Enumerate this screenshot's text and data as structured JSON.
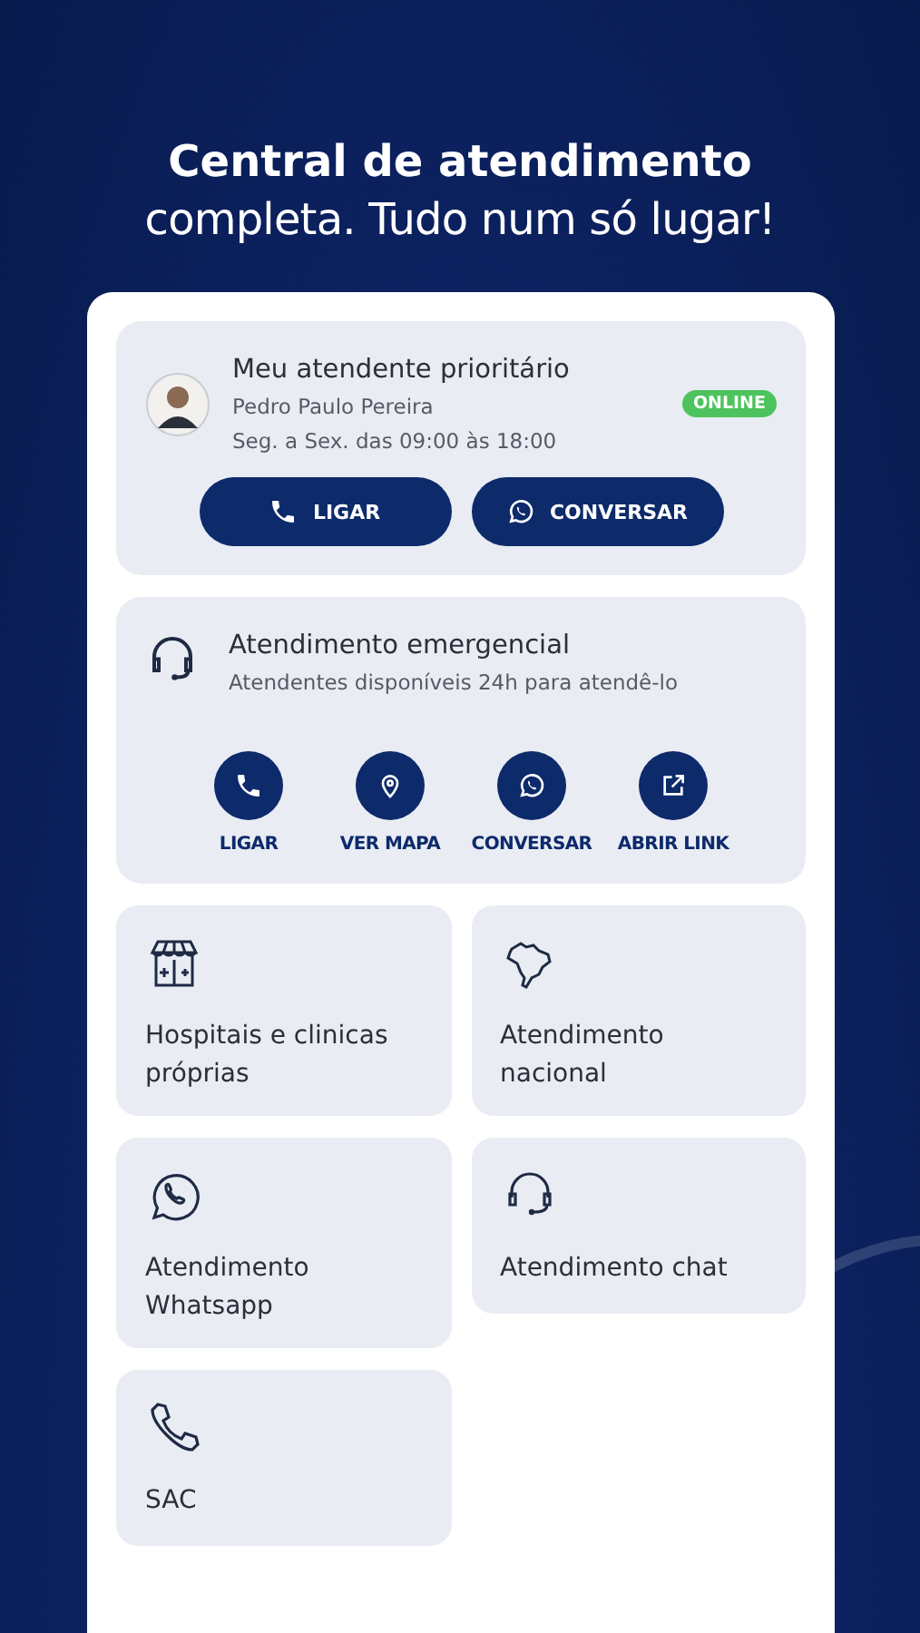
{
  "headline": {
    "bold": "Central de atendimento",
    "regular": "completa. Tudo num só lugar!"
  },
  "priority": {
    "title": "Meu atendente prioritário",
    "name": "Pedro Paulo Pereira",
    "hours": "Seg. a Sex. das 09:00 às 18:00",
    "status": "ONLINE",
    "buttons": [
      "LIGAR",
      "CONVERSAR"
    ]
  },
  "emergency": {
    "title": "Atendimento emergencial",
    "subtitle": "Atendentes disponíveis 24h para atendê-lo",
    "actions": [
      "LIGAR",
      "VER MAPA",
      "CONVERSAR",
      "ABRIR LINK"
    ]
  },
  "tiles": [
    "Hospitais e clinicas próprias",
    "Atendimento nacional",
    "Atendimento Whatsapp",
    "Atendimento chat",
    "SAC"
  ]
}
